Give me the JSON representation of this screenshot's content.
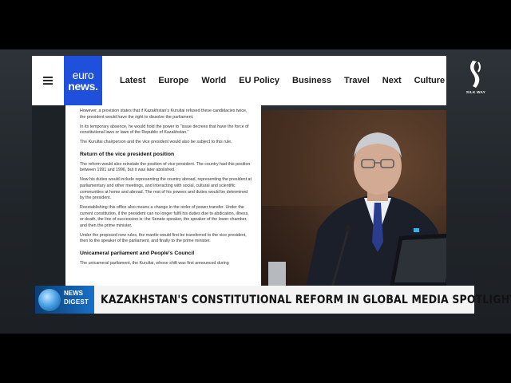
{
  "navbar": {
    "logo_line1": "euro",
    "logo_line2": "news.",
    "items": [
      "Latest",
      "Europe",
      "World",
      "EU Policy",
      "Business",
      "Travel",
      "Next",
      "Culture"
    ]
  },
  "article": {
    "paragraphs_1": [
      "However, a provision states that if Kazakhstan's Kurultai refused these candidacies twice, the president would have the right to dissolve the parliament.",
      "In its temporary absence, he would hold the power to \"issue decrees that have the force of constitutional laws or laws of the Republic of Kazakhstan.\"",
      "The Kurultai chairperson and the vice president would also be subject to this rule."
    ],
    "heading_1": "Return of the vice president position",
    "paragraphs_2": [
      "The reform would also reinstate the position of vice president. The country had this position between 1991 and 1996, but it was later abolished.",
      "Now his duties would include representing the country abroad, representing the president at parliamentary and other meetings, and interacting with social, cultural and scientific communities at home and abroad. The rest of his powers and duties would be determined by the president.",
      "Reestablishing this office also means a change in the order of power transfer. Under the current constitution, if the president can no longer fulfil his duties due to abdication, illness, or death, the line of succession is: the Senate speaker, the speaker of the lower chamber, and then the prime minister.",
      "Under the proposed new rules, the mantle would first be transferred to the vice president, then to the speaker of the parliament, and finally to the prime minister."
    ],
    "heading_2": "Unicameral parliament and People's Council",
    "paragraphs_3": [
      "The unicameral parliament, the Kurultai, whose shift was first announced during"
    ]
  },
  "channel_logo": {
    "text": "SILK WAY"
  },
  "lower_third": {
    "tag_line1": "NEWS",
    "tag_line2": "DIGEST",
    "headline": "KAZAKHSTAN'S CONSTITUTIONAL REFORM IN GLOBAL MEDIA SPOTLIGHT"
  },
  "colors": {
    "brand": "#1e50dc",
    "ticker": "#1770c8",
    "headline_bg": "#f4f4f4"
  }
}
